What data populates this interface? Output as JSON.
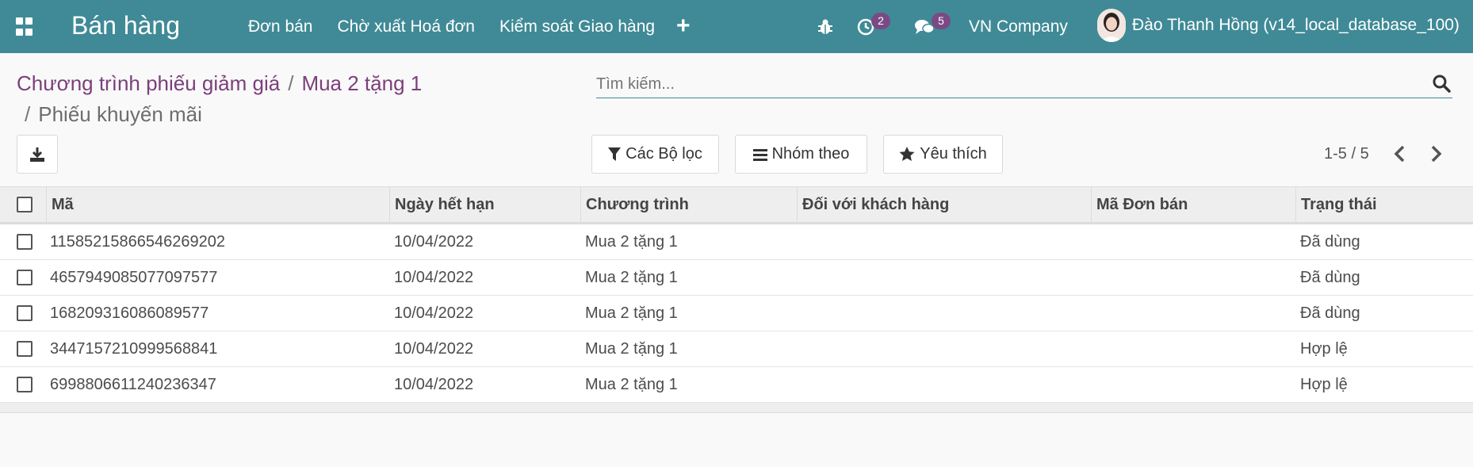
{
  "navbar": {
    "app_title": "Bán hàng",
    "menu": [
      "Đơn bán",
      "Chờ xuất Hoá đơn",
      "Kiểm soát Giao hàng"
    ],
    "activity_count": "2",
    "message_count": "5",
    "company": "VN Company",
    "user": "Đào Thanh Hồng (v14_local_database_100)",
    "color": "#3f8a96"
  },
  "breadcrumb": {
    "items": [
      "Chương trình phiếu giảm giá",
      "Mua 2 tặng 1"
    ],
    "current": "Phiếu khuyến mãi",
    "separator": "/"
  },
  "search": {
    "placeholder": "Tìm kiếm..."
  },
  "toolbar": {
    "filters_label": "Các Bộ lọc",
    "groupby_label": "Nhóm theo",
    "favorites_label": "Yêu thích",
    "pager": "1-5 / 5"
  },
  "table": {
    "columns": [
      "Mã",
      "Ngày hết hạn",
      "Chương trình",
      "Đối với khách hàng",
      "Mã Đơn bán",
      "Trạng thái"
    ],
    "rows": [
      {
        "code": "11585215866546269202",
        "expiry": "10/04/2022",
        "program": "Mua 2 tặng 1",
        "customer": "",
        "order": "",
        "status": "Đã dùng"
      },
      {
        "code": "4657949085077097577",
        "expiry": "10/04/2022",
        "program": "Mua 2 tặng 1",
        "customer": "",
        "order": "",
        "status": "Đã dùng"
      },
      {
        "code": "168209316086089577",
        "expiry": "10/04/2022",
        "program": "Mua 2 tặng 1",
        "customer": "",
        "order": "",
        "status": "Đã dùng"
      },
      {
        "code": "3447157210999568841",
        "expiry": "10/04/2022",
        "program": "Mua 2 tặng 1",
        "customer": "",
        "order": "",
        "status": "Hợp lệ"
      },
      {
        "code": "6998806611240236347",
        "expiry": "10/04/2022",
        "program": "Mua 2 tặng 1",
        "customer": "",
        "order": "",
        "status": "Hợp lệ"
      }
    ]
  }
}
